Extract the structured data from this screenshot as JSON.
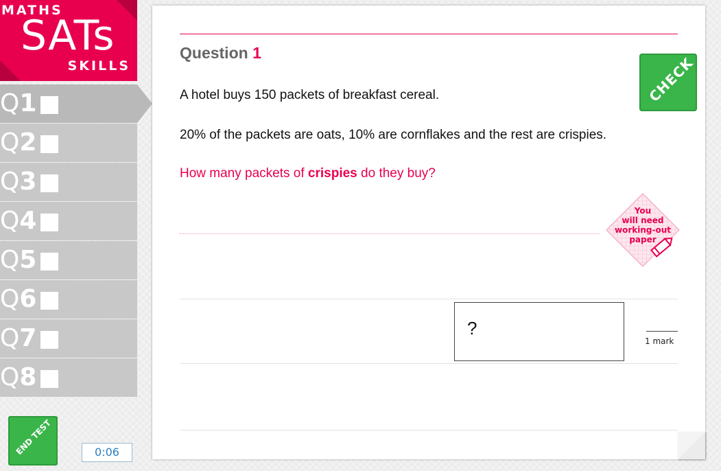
{
  "logo": {
    "line1": "MATHS",
    "line2": "SATs",
    "line3": "SKILLS"
  },
  "nav": {
    "items": [
      {
        "q": "Q",
        "num": "1",
        "active": true
      },
      {
        "q": "Q",
        "num": "2",
        "active": false
      },
      {
        "q": "Q",
        "num": "3",
        "active": false
      },
      {
        "q": "Q",
        "num": "4",
        "active": false
      },
      {
        "q": "Q",
        "num": "5",
        "active": false
      },
      {
        "q": "Q",
        "num": "6",
        "active": false
      },
      {
        "q": "Q",
        "num": "7",
        "active": false
      },
      {
        "q": "Q",
        "num": "8",
        "active": false
      }
    ]
  },
  "end_test": {
    "label": "END TEST"
  },
  "timer": {
    "value": "0:06"
  },
  "question": {
    "label": "Question",
    "number": "1",
    "line1": "A hotel buys 150 packets of breakfast cereal.",
    "line2": "20% of the packets are oats, 10% are cornflakes and the rest are crispies.",
    "ask_pre": "How many packets of ",
    "ask_bold": "crispies",
    "ask_post": " do they buy?"
  },
  "check": {
    "label": "CHECK"
  },
  "working_out": {
    "line1": "You",
    "line2": "will need",
    "line3": "working-out",
    "line4": "paper"
  },
  "answer": {
    "value": "?"
  },
  "marks": {
    "label": "1 mark"
  },
  "colors": {
    "brand": "#e8004f",
    "button": "#3ab54a",
    "timer": "#2b7fbf"
  }
}
